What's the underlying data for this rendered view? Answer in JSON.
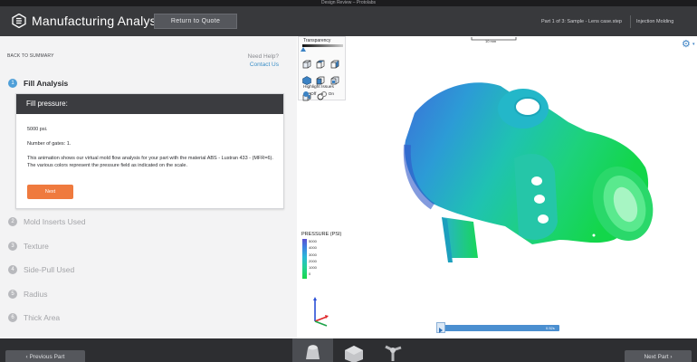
{
  "window": {
    "title": "Design Review – Protolabs"
  },
  "header": {
    "app_title": "Manufacturing Analysis",
    "return_button": "Return to Quote",
    "part_info": "Part 1 of 3:  Sample - Lens case.step",
    "process": "Injection Molding"
  },
  "sidebar": {
    "back_link": "BACK TO SUMMARY",
    "help_question": "Need Help?",
    "help_link": "Contact Us",
    "steps": [
      {
        "num": "1",
        "label": "Fill Analysis"
      },
      {
        "num": "2",
        "label": "Mold Inserts Used"
      },
      {
        "num": "3",
        "label": "Texture"
      },
      {
        "num": "4",
        "label": "Side-Pull Used"
      },
      {
        "num": "5",
        "label": "Radius"
      },
      {
        "num": "6",
        "label": "Thick Area"
      }
    ],
    "card": {
      "title": "Fill pressure:",
      "pressure": "5000 psi.",
      "gates": "Number of gates: 1.",
      "description": "This animation shows our virtual mold flow analysis for your part with the material ABS - Lustran 433 - (MFR=6). The various colors represent the pressure field as indicated on the scale.",
      "next_button": "Next"
    }
  },
  "viewer": {
    "transparency_label": "Transparency",
    "highlight_label": "Highlight Issues",
    "off_label": "Off",
    "on_label": "On",
    "scale_label": "10 mm",
    "legend_title": "PRESSURE (PSI)",
    "legend_values": [
      "5000",
      "4000",
      "3000",
      "2000",
      "1000",
      "0"
    ],
    "time_label": "0.52s",
    "colors": {
      "accent": "#3b82c4",
      "next_orange": "#ef7a3e"
    }
  },
  "footer": {
    "prev_button": "‹ Previous Part",
    "next_button": "Next Part ›"
  }
}
